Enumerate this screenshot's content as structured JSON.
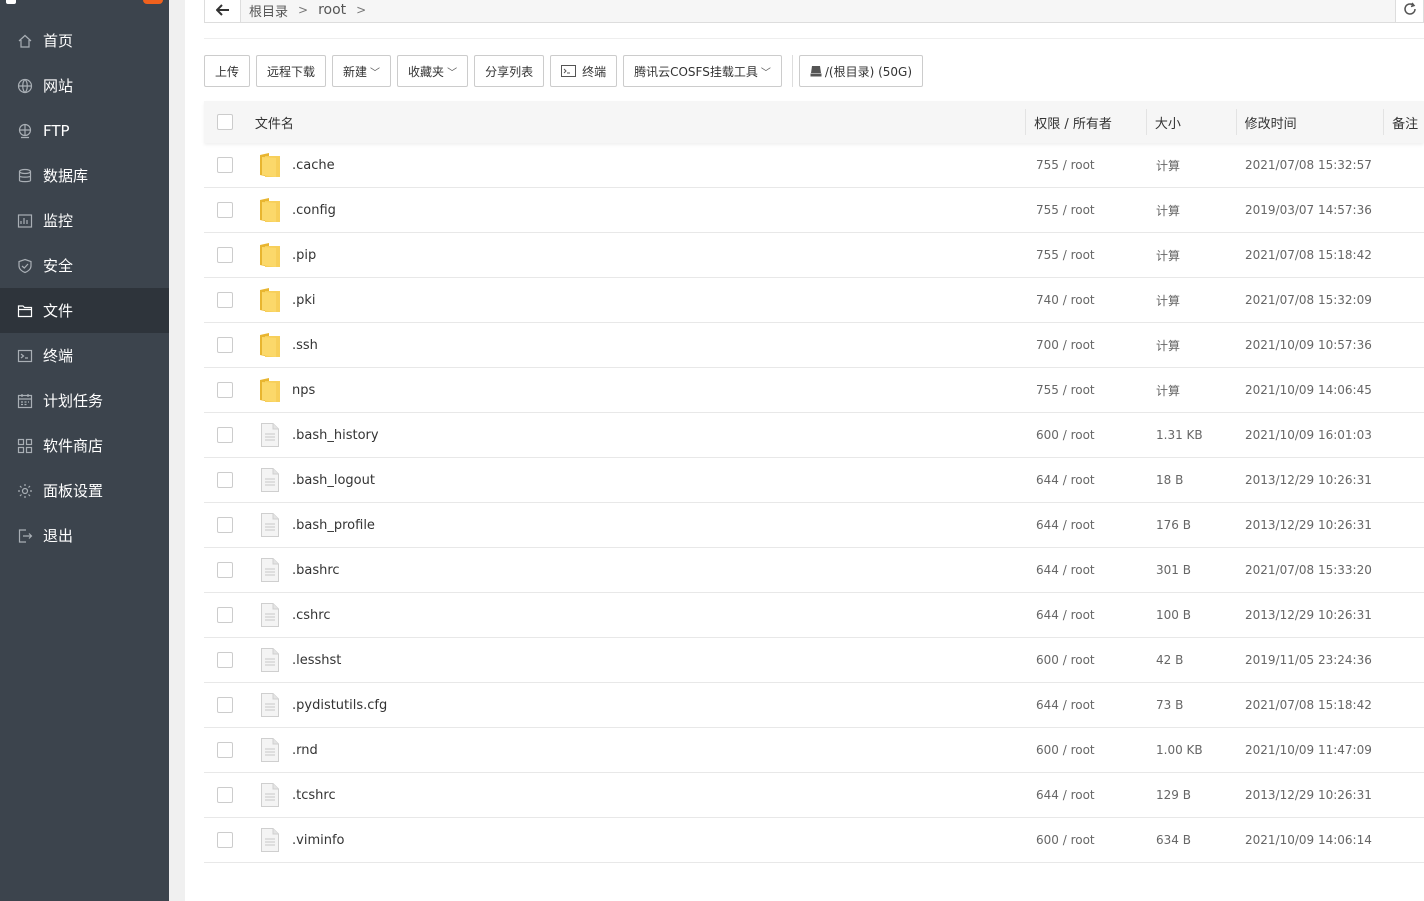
{
  "sidebar": {
    "items": [
      {
        "label": "首页",
        "icon": "home-icon"
      },
      {
        "label": "网站",
        "icon": "globe-icon"
      },
      {
        "label": "FTP",
        "icon": "ftp-icon"
      },
      {
        "label": "数据库",
        "icon": "database-icon"
      },
      {
        "label": "监控",
        "icon": "monitor-icon"
      },
      {
        "label": "安全",
        "icon": "shield-icon"
      },
      {
        "label": "文件",
        "icon": "folder-icon",
        "active": true
      },
      {
        "label": "终端",
        "icon": "terminal-icon"
      },
      {
        "label": "计划任务",
        "icon": "calendar-icon"
      },
      {
        "label": "软件商店",
        "icon": "grid-icon"
      },
      {
        "label": "面板设置",
        "icon": "gear-icon"
      },
      {
        "label": "退出",
        "icon": "logout-icon"
      }
    ]
  },
  "path": {
    "crumbs": [
      "根目录",
      "root"
    ]
  },
  "toolbar": {
    "upload": "上传",
    "remote_download": "远程下载",
    "new": "新建",
    "favorites": "收藏夹",
    "share_list": "分享列表",
    "terminal": "终端",
    "cosfs": "腾讯云COSFS挂载工具",
    "disk": "/(根目录) (50G)"
  },
  "table": {
    "headers": {
      "name": "文件名",
      "perm": "权限 / 所有者",
      "size": "大小",
      "mtime": "修改时间",
      "note": "备注"
    },
    "rows": [
      {
        "type": "folder",
        "name": ".cache",
        "perm": "755 / root",
        "size": "计算",
        "mtime": "2021/07/08 15:32:57"
      },
      {
        "type": "folder",
        "name": ".config",
        "perm": "755 / root",
        "size": "计算",
        "mtime": "2019/03/07 14:57:36"
      },
      {
        "type": "folder",
        "name": ".pip",
        "perm": "755 / root",
        "size": "计算",
        "mtime": "2021/07/08 15:18:42"
      },
      {
        "type": "folder",
        "name": ".pki",
        "perm": "740 / root",
        "size": "计算",
        "mtime": "2021/07/08 15:32:09"
      },
      {
        "type": "folder",
        "name": ".ssh",
        "perm": "700 / root",
        "size": "计算",
        "mtime": "2021/10/09 10:57:36"
      },
      {
        "type": "folder",
        "name": "nps",
        "perm": "755 / root",
        "size": "计算",
        "mtime": "2021/10/09 14:06:45"
      },
      {
        "type": "file",
        "name": ".bash_history",
        "perm": "600 / root",
        "size": "1.31 KB",
        "mtime": "2021/10/09 16:01:03"
      },
      {
        "type": "file",
        "name": ".bash_logout",
        "perm": "644 / root",
        "size": "18 B",
        "mtime": "2013/12/29 10:26:31"
      },
      {
        "type": "file",
        "name": ".bash_profile",
        "perm": "644 / root",
        "size": "176 B",
        "mtime": "2013/12/29 10:26:31"
      },
      {
        "type": "file",
        "name": ".bashrc",
        "perm": "644 / root",
        "size": "301 B",
        "mtime": "2021/07/08 15:33:20"
      },
      {
        "type": "file",
        "name": ".cshrc",
        "perm": "644 / root",
        "size": "100 B",
        "mtime": "2013/12/29 10:26:31"
      },
      {
        "type": "file",
        "name": ".lesshst",
        "perm": "600 / root",
        "size": "42 B",
        "mtime": "2019/11/05 23:24:36"
      },
      {
        "type": "file",
        "name": ".pydistutils.cfg",
        "perm": "644 / root",
        "size": "73 B",
        "mtime": "2021/07/08 15:18:42"
      },
      {
        "type": "file",
        "name": ".rnd",
        "perm": "600 / root",
        "size": "1.00 KB",
        "mtime": "2021/10/09 11:47:09"
      },
      {
        "type": "file",
        "name": ".tcshrc",
        "perm": "644 / root",
        "size": "129 B",
        "mtime": "2013/12/29 10:26:31"
      },
      {
        "type": "file",
        "name": ".viminfo",
        "perm": "600 / root",
        "size": "634 B",
        "mtime": "2021/10/09 14:06:14"
      }
    ]
  },
  "colors": {
    "sidebar_bg": "#3c444d",
    "sidebar_active": "#2e343b",
    "calc_green": "#20a53a",
    "folder_yellow": "#f7c948",
    "badge_orange": "#f0611d"
  }
}
